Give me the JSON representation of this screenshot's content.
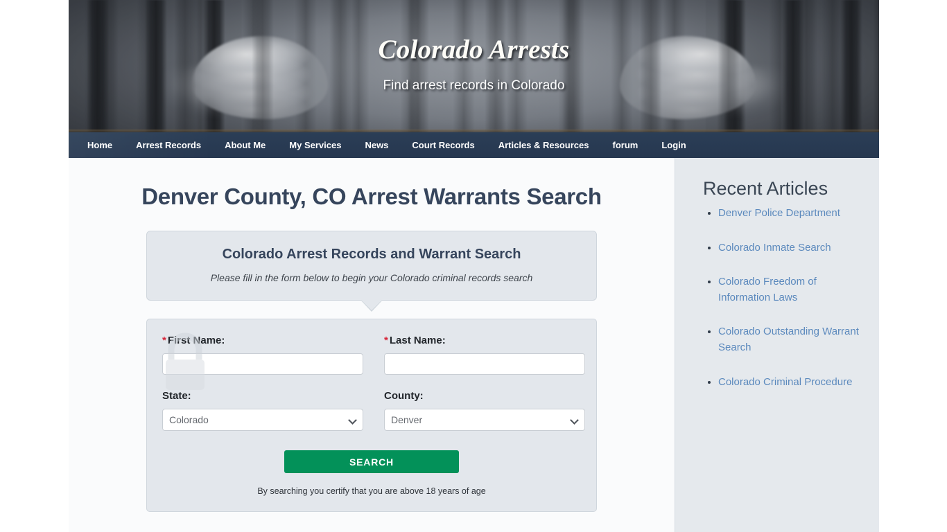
{
  "site": {
    "title": "Colorado Arrests",
    "tagline": "Find arrest records in Colorado"
  },
  "nav": {
    "items": [
      {
        "label": "Home",
        "name": "nav-item-home"
      },
      {
        "label": "Arrest Records",
        "name": "nav-item-arrest-records"
      },
      {
        "label": "About Me",
        "name": "nav-item-about-me"
      },
      {
        "label": "My Services",
        "name": "nav-item-my-services"
      },
      {
        "label": "News",
        "name": "nav-item-news"
      },
      {
        "label": "Court Records",
        "name": "nav-item-court-records"
      },
      {
        "label": "Articles & Resources",
        "name": "nav-item-articles-resources"
      },
      {
        "label": "forum",
        "name": "nav-item-forum"
      },
      {
        "label": "Login",
        "name": "nav-item-login"
      }
    ]
  },
  "main": {
    "page_title": "Denver County, CO Arrest Warrants Search",
    "intro": {
      "title": "Colorado Arrest Records and Warrant Search",
      "subtitle": "Please fill in the form below to begin your Colorado criminal records search"
    },
    "form": {
      "required_marker": "*",
      "first_name_label": "First Name:",
      "first_name_value": "",
      "first_name_placeholder": "",
      "last_name_label": "Last Name:",
      "last_name_value": "",
      "last_name_placeholder": "",
      "state_label": "State:",
      "state_value": "Colorado",
      "state_options": [
        "Colorado"
      ],
      "county_label": "County:",
      "county_value": "Denver",
      "county_options": [
        "Denver"
      ],
      "submit_label": "SEARCH",
      "disclaimer": "By searching you certify that you are above 18 years of age"
    }
  },
  "sidebar": {
    "title": "Recent Articles",
    "articles": [
      {
        "label": "Denver Police Department"
      },
      {
        "label": "Colorado Inmate Search"
      },
      {
        "label": "Colorado Freedom of Information Laws"
      },
      {
        "label": "Colorado Outstanding Warrant Search"
      },
      {
        "label": "Colorado Criminal Procedure"
      }
    ]
  },
  "colors": {
    "nav_bar": "#293c54",
    "heading": "#36455c",
    "accent_green": "#039159",
    "link_blue": "#5b89bd",
    "required_red": "#d6283b",
    "panel_bg": "#e3e7ec",
    "sidebar_bg": "#e5e9ed"
  }
}
